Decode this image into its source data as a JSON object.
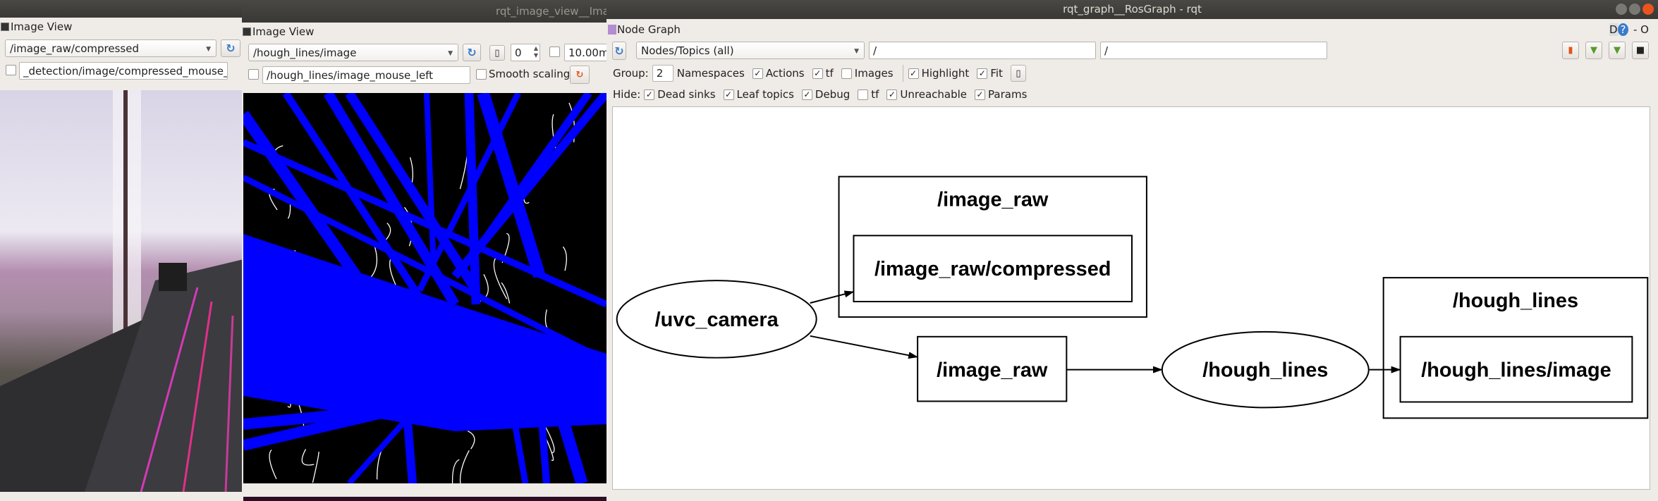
{
  "left_window": {
    "plugin_title": "Image View",
    "topic": "/image_raw/compressed",
    "mouse_topic": "_detection/image/compressed_mouse_left"
  },
  "middle_window": {
    "window_title": "rqt_image_view__Ima",
    "plugin_title": "Image View",
    "topic": "/hough_lines/image",
    "spin_value": "0",
    "max_range": "10.00m",
    "mouse_topic": "/hough_lines/image_mouse_left",
    "smooth_scaling_label": "Smooth scaling",
    "smooth_scaling_checked": false
  },
  "right_window": {
    "window_title": "rqt_graph__RosGraph - rqt",
    "plugin_title": "Node Graph",
    "corner_labels": [
      "D",
      "?",
      "- O"
    ],
    "mode": "Nodes/Topics (all)",
    "node_filter": "/",
    "topic_filter": "/",
    "group_label": "Group:",
    "group_value": "2",
    "options": [
      {
        "label": "Namespaces",
        "checked": true
      },
      {
        "label": "Actions",
        "checked": true
      },
      {
        "label": "tf",
        "checked": true
      },
      {
        "label": "Images",
        "checked": false
      }
    ],
    "options2": [
      {
        "label": "Highlight",
        "checked": true
      },
      {
        "label": "Fit",
        "checked": true
      }
    ],
    "hide_label": "Hide:",
    "hide_options": [
      {
        "label": "Dead sinks",
        "checked": true
      },
      {
        "label": "Leaf topics",
        "checked": true
      },
      {
        "label": "Debug",
        "checked": true
      },
      {
        "label": "tf",
        "checked": false
      },
      {
        "label": "Unreachable",
        "checked": true
      },
      {
        "label": "Params",
        "checked": true
      }
    ],
    "graph": {
      "clusters": [
        {
          "label": "/image_raw"
        },
        {
          "label": "/hough_lines"
        }
      ],
      "topics": [
        {
          "label": "/image_raw/compressed"
        },
        {
          "label": "/image_raw"
        },
        {
          "label": "/hough_lines/image"
        }
      ],
      "nodes": [
        {
          "label": "/uvc_camera"
        },
        {
          "label": "/hough_lines"
        }
      ],
      "edges": [
        [
          "/uvc_camera",
          "/image_raw/compressed"
        ],
        [
          "/uvc_camera",
          "/image_raw"
        ],
        [
          "/image_raw",
          "/hough_lines"
        ],
        [
          "/hough_lines",
          "/hough_lines/image"
        ]
      ]
    }
  },
  "colors": {
    "hough_line": "#0000ff",
    "titlebar": "#3c3b37",
    "panel": "#efebe7"
  }
}
